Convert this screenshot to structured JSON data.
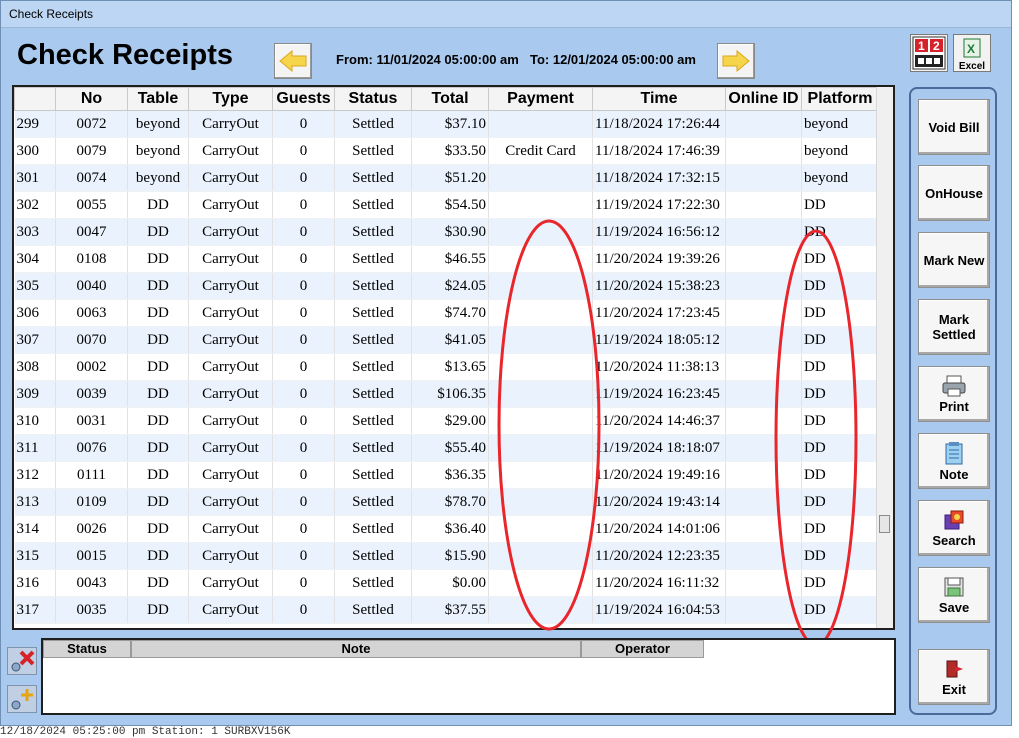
{
  "window_title": "Check Receipts",
  "header": {
    "title": "Check Receipts",
    "from_label": "From: 11/01/2024 05:00:00 am",
    "to_label": "To: 12/01/2024 05:00:00 am",
    "excel_label": "Excel"
  },
  "table": {
    "columns": [
      "",
      "No",
      "Table",
      "Type",
      "Guests",
      "Status",
      "Total",
      "Payment",
      "Time",
      "Online ID",
      "Platform"
    ],
    "rows": [
      [
        "299",
        "0072",
        "beyond",
        "CarryOut",
        "0",
        "Settled",
        "$37.10",
        "",
        "11/18/2024 17:26:44",
        "",
        "beyond"
      ],
      [
        "300",
        "0079",
        "beyond",
        "CarryOut",
        "0",
        "Settled",
        "$33.50",
        "Credit Card",
        "11/18/2024 17:46:39",
        "",
        "beyond"
      ],
      [
        "301",
        "0074",
        "beyond",
        "CarryOut",
        "0",
        "Settled",
        "$51.20",
        "",
        "11/18/2024 17:32:15",
        "",
        "beyond"
      ],
      [
        "302",
        "0055",
        "DD",
        "CarryOut",
        "0",
        "Settled",
        "$54.50",
        "",
        "11/19/2024 17:22:30",
        "",
        "DD"
      ],
      [
        "303",
        "0047",
        "DD",
        "CarryOut",
        "0",
        "Settled",
        "$30.90",
        "",
        "11/19/2024 16:56:12",
        "",
        "DD"
      ],
      [
        "304",
        "0108",
        "DD",
        "CarryOut",
        "0",
        "Settled",
        "$46.55",
        "",
        "11/20/2024 19:39:26",
        "",
        "DD"
      ],
      [
        "305",
        "0040",
        "DD",
        "CarryOut",
        "0",
        "Settled",
        "$24.05",
        "",
        "11/20/2024 15:38:23",
        "",
        "DD"
      ],
      [
        "306",
        "0063",
        "DD",
        "CarryOut",
        "0",
        "Settled",
        "$74.70",
        "",
        "11/20/2024 17:23:45",
        "",
        "DD"
      ],
      [
        "307",
        "0070",
        "DD",
        "CarryOut",
        "0",
        "Settled",
        "$41.05",
        "",
        "11/19/2024 18:05:12",
        "",
        "DD"
      ],
      [
        "308",
        "0002",
        "DD",
        "CarryOut",
        "0",
        "Settled",
        "$13.65",
        "",
        "11/20/2024 11:38:13",
        "",
        "DD"
      ],
      [
        "309",
        "0039",
        "DD",
        "CarryOut",
        "0",
        "Settled",
        "$106.35",
        "",
        "11/19/2024 16:23:45",
        "",
        "DD"
      ],
      [
        "310",
        "0031",
        "DD",
        "CarryOut",
        "0",
        "Settled",
        "$29.00",
        "",
        "11/20/2024 14:46:37",
        "",
        "DD"
      ],
      [
        "311",
        "0076",
        "DD",
        "CarryOut",
        "0",
        "Settled",
        "$55.40",
        "",
        "11/19/2024 18:18:07",
        "",
        "DD"
      ],
      [
        "312",
        "0111",
        "DD",
        "CarryOut",
        "0",
        "Settled",
        "$36.35",
        "",
        "11/20/2024 19:49:16",
        "",
        "DD"
      ],
      [
        "313",
        "0109",
        "DD",
        "CarryOut",
        "0",
        "Settled",
        "$78.70",
        "",
        "11/20/2024 19:43:14",
        "",
        "DD"
      ],
      [
        "314",
        "0026",
        "DD",
        "CarryOut",
        "0",
        "Settled",
        "$36.40",
        "",
        "11/20/2024 14:01:06",
        "",
        "DD"
      ],
      [
        "315",
        "0015",
        "DD",
        "CarryOut",
        "0",
        "Settled",
        "$15.90",
        "",
        "11/20/2024 12:23:35",
        "",
        "DD"
      ],
      [
        "316",
        "0043",
        "DD",
        "CarryOut",
        "0",
        "Settled",
        "$0.00",
        "",
        "11/20/2024 16:11:32",
        "",
        "DD"
      ],
      [
        "317",
        "0035",
        "DD",
        "CarryOut",
        "0",
        "Settled",
        "$37.55",
        "",
        "11/19/2024 16:04:53",
        "",
        "DD"
      ]
    ]
  },
  "note_table": {
    "columns": [
      "Status",
      "Note",
      "Operator"
    ]
  },
  "side_buttons": {
    "void_bill": "Void Bill",
    "onhouse": "OnHouse",
    "mark_new": "Mark New",
    "mark_settled": "Mark Settled",
    "print": "Print",
    "note": "Note",
    "search": "Search",
    "save": "Save",
    "exit": "Exit"
  },
  "statusbar": "12/18/2024 05:25:00 pm  Station: 1    SURBXV156K",
  "colors": {
    "window_bg": "#a9c9ef",
    "row_alt": "#eaf3fd",
    "annotation_red": "#e8262b",
    "arrow_yellow": "#f7d54a"
  }
}
